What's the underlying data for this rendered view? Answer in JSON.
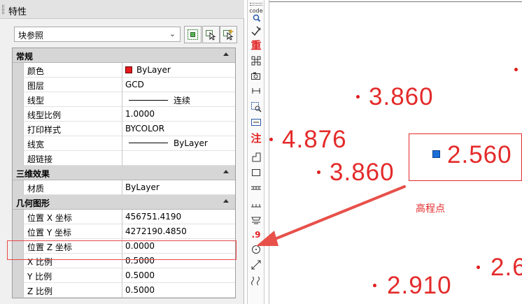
{
  "panel": {
    "title": "特性",
    "object_type": "块参照",
    "buttons": [
      "toggle-pickadd-icon",
      "select-objects-icon",
      "quick-select-icon"
    ],
    "categories": [
      {
        "label": "常规",
        "rows": [
          {
            "name": "颜色",
            "value": "ByLayer",
            "swatch": "#e41a1c"
          },
          {
            "name": "图层",
            "value": "GCD"
          },
          {
            "name": "线型",
            "value": "连续",
            "linesample": true
          },
          {
            "name": "线型比例",
            "value": "1.0000"
          },
          {
            "name": "打印样式",
            "value": "BYCOLOR"
          },
          {
            "name": "线宽",
            "value": "ByLayer",
            "linesample": true
          },
          {
            "name": "超链接",
            "value": ""
          }
        ]
      },
      {
        "label": "三维效果",
        "rows": [
          {
            "name": "材质",
            "value": "ByLayer"
          }
        ]
      },
      {
        "label": "几何图形",
        "rows": [
          {
            "name": "位置 X 坐标",
            "value": "456751.4190"
          },
          {
            "name": "位置 Y 坐标",
            "value": "4272190.4850"
          },
          {
            "name": "位置 Z 坐标",
            "value": "0.0000"
          },
          {
            "name": "X 比例",
            "value": "0.5000"
          },
          {
            "name": "Y 比例",
            "value": "0.5000"
          },
          {
            "name": "Z 比例",
            "value": "0.5000"
          }
        ]
      }
    ]
  },
  "toolbar": {
    "items": [
      {
        "name": "code-search-tool",
        "label": "code"
      },
      {
        "name": "edit-tool",
        "label": ""
      },
      {
        "name": "chong-tool",
        "label": "重"
      },
      {
        "name": "grid-points-tool",
        "label": ""
      },
      {
        "name": "camera-tool",
        "label": ""
      },
      {
        "name": "dimension-tool",
        "label": ""
      },
      {
        "name": "zoom-points-tool",
        "label": ""
      },
      {
        "name": "zoom-range-tool",
        "label": ""
      },
      {
        "name": "zhu-tool",
        "label": "注"
      },
      {
        "name": "corner-tool",
        "label": ""
      },
      {
        "name": "rectangle-tool",
        "label": ""
      },
      {
        "name": "track-tool",
        "label": ""
      },
      {
        "name": "ladder-tool",
        "label": ""
      },
      {
        "name": "layers-tool",
        "label": ""
      },
      {
        "name": "elevation-point-tool",
        "label": ".9"
      },
      {
        "name": "circle-tool",
        "label": ""
      },
      {
        "name": "diagonal-tool",
        "label": ""
      },
      {
        "name": "wave-tool",
        "label": ""
      }
    ]
  },
  "drawing": {
    "accent_color": "#e42a2a",
    "grip_color": "#1a6ed8",
    "elevations": [
      "3.860",
      "4.876",
      "3.860",
      "2.560",
      "2.910",
      "2.6"
    ],
    "annotation": "高程点"
  }
}
